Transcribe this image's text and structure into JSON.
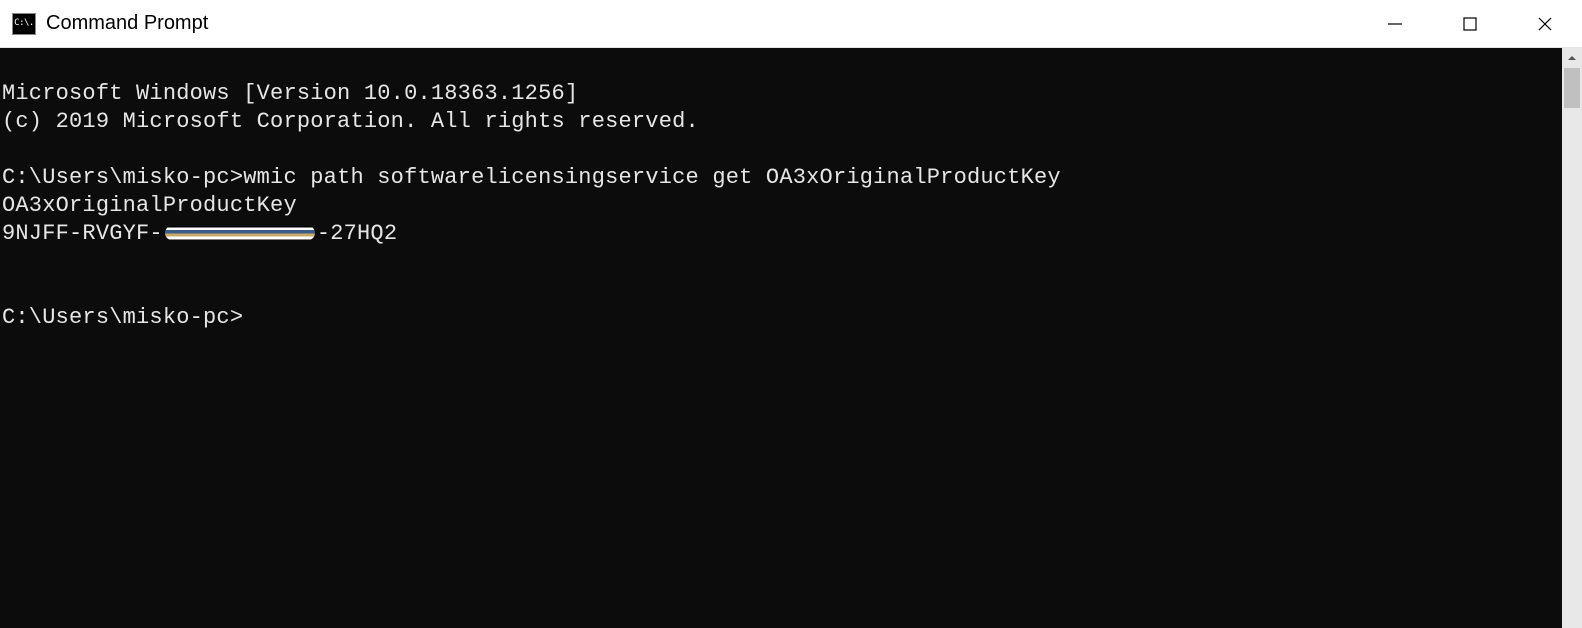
{
  "window": {
    "title": "Command Prompt",
    "icon_text": "C:\\."
  },
  "terminal": {
    "version_line": "Microsoft Windows [Version 10.0.18363.1256]",
    "copyright_line": "(c) 2019 Microsoft Corporation. All rights reserved.",
    "prompt1_prefix": "C:\\Users\\misko-pc>",
    "command1": "wmic path softwarelicensingservice get OA3xOriginalProductKey",
    "output_header": "OA3xOriginalProductKey",
    "key_part1": "9NJFF-RVGYF-",
    "key_part2": "-27HQ2",
    "prompt2_prefix": "C:\\Users\\misko-pc>"
  }
}
